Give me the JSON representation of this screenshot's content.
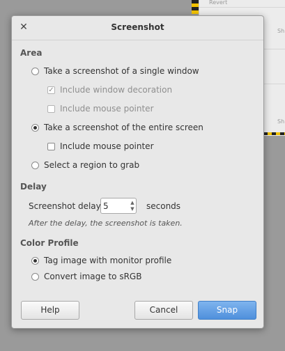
{
  "background": {
    "revert_label": "Revert",
    "side_label_1": "Sh",
    "side_label_2": "Sh"
  },
  "dialog": {
    "title": "Screenshot",
    "close_icon": "close-icon"
  },
  "area": {
    "title": "Area",
    "single_window": "Take a screenshot of a single window",
    "include_decoration": "Include window decoration",
    "include_pointer_window": "Include mouse pointer",
    "entire_screen": "Take a screenshot of the entire screen",
    "include_pointer_screen": "Include mouse pointer",
    "region": "Select a region to grab",
    "selected": "entire_screen"
  },
  "delay": {
    "title": "Delay",
    "label": "Screenshot delay:",
    "value": "5",
    "unit": "seconds",
    "hint": "After the delay, the screenshot is taken."
  },
  "color_profile": {
    "title": "Color Profile",
    "tag_monitor": "Tag image with monitor profile",
    "convert_srgb": "Convert image to sRGB",
    "selected": "tag_monitor"
  },
  "buttons": {
    "help": "Help",
    "cancel": "Cancel",
    "snap": "Snap"
  },
  "colors": {
    "accent": "#4f90dc",
    "dialog_bg": "#e8e8e8"
  }
}
